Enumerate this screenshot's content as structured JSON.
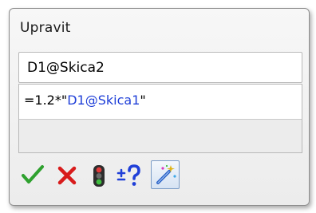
{
  "dialog": {
    "title": "Upravit"
  },
  "dimension_name": {
    "value": "D1@Skica2"
  },
  "equation": {
    "prefix": "=1.2*",
    "quote_open": "\"",
    "reference": "D1@Skica1",
    "quote_close": "\""
  },
  "toolbar": {
    "buttons": [
      {
        "name": "ok",
        "icon": "checkmark-icon",
        "color": "#2fa12f"
      },
      {
        "name": "cancel",
        "icon": "close-x-icon",
        "color": "#d81c1c"
      },
      {
        "name": "rebuild",
        "icon": "traffic-light-icon",
        "color": "#2d2d2d"
      },
      {
        "name": "tolerance",
        "icon": "plus-minus-question-icon",
        "color": "#1f3fd8"
      },
      {
        "name": "magic-tool",
        "icon": "magic-wand-icon",
        "color": "#2a62c8"
      }
    ]
  },
  "colors": {
    "reference_text": "#1f3fd8",
    "ok_green": "#2fa12f",
    "cancel_red": "#d81c1c"
  }
}
